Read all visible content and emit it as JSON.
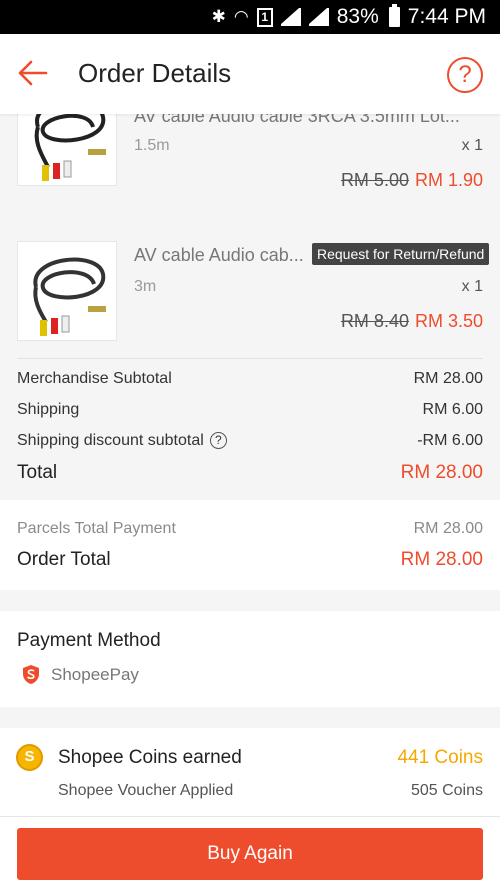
{
  "status_bar": {
    "battery": "83%",
    "time": "7:44 PM",
    "sim_slot": "1"
  },
  "header": {
    "title": "Order Details",
    "help_glyph": "?"
  },
  "items": [
    {
      "name": "AV cable Audio cable 3RCA 3.5mm Lot...",
      "variant": "1.5m",
      "qty": "x 1",
      "old_price": "RM 5.00",
      "new_price": "RM 1.90"
    },
    {
      "name": "AV cable Audio cab...",
      "variant": "3m",
      "qty": "x 1",
      "old_price": "RM 8.40",
      "new_price": "RM 3.50",
      "badge": "Request for Return/Refund"
    }
  ],
  "summary": {
    "merch_label": "Merchandise Subtotal",
    "merch_value": "RM 28.00",
    "ship_label": "Shipping",
    "ship_value": "RM 6.00",
    "shipdisc_label": "Shipping discount subtotal",
    "shipdisc_value": "-RM 6.00",
    "total_label": "Total",
    "total_value": "RM 28.00"
  },
  "payment_totals": {
    "parcels_label": "Parcels Total Payment",
    "parcels_value": "RM 28.00",
    "order_label": "Order Total",
    "order_value": "RM 28.00"
  },
  "payment_method": {
    "title": "Payment Method",
    "method": "ShopeePay"
  },
  "coins": {
    "earned_label": "Shopee Coins earned",
    "earned_value": "441 Coins",
    "voucher_label": "Shopee Voucher Applied",
    "voucher_value": "505 Coins",
    "coin_glyph": "S"
  },
  "bottom": {
    "buy_again": "Buy Again"
  },
  "colors": {
    "accent": "#ee4d2d",
    "coin": "#f7b500",
    "badge_bg": "#444444"
  }
}
